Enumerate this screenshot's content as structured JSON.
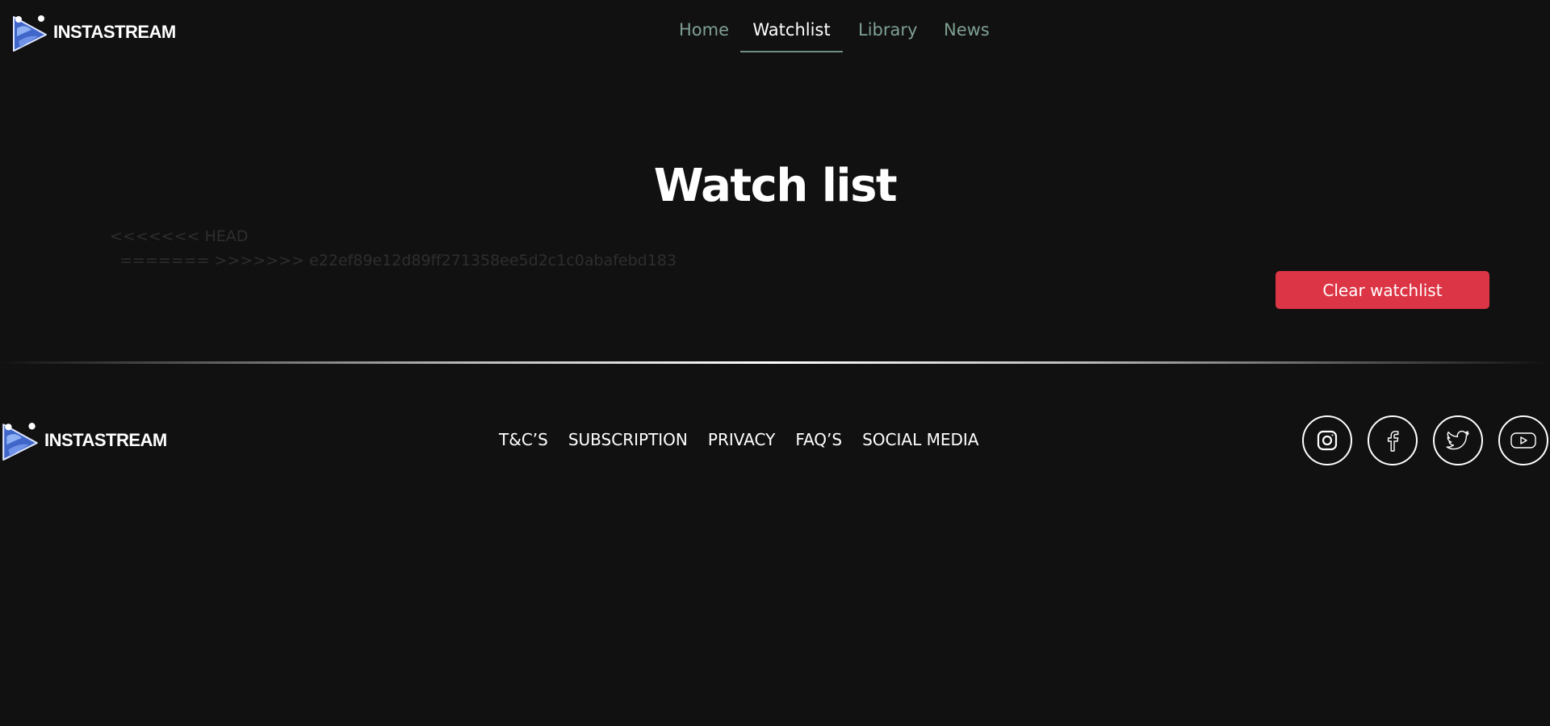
{
  "brand": {
    "name": "INSTASTREAM",
    "logo_icon": "play-logo-icon"
  },
  "nav": {
    "items": [
      {
        "label": "Home",
        "active": false
      },
      {
        "label": "Watchlist",
        "active": true
      },
      {
        "label": "Library",
        "active": false
      },
      {
        "label": "News",
        "active": false
      }
    ]
  },
  "main": {
    "title": "Watch list",
    "conflict_lines": [
      "<<<<<<< HEAD",
      "  ======= >>>>>>> e22ef89e12d89ff271358ee5d2c1c0abafebd183"
    ],
    "clear_button": "Clear watchlist"
  },
  "footer": {
    "links": [
      "T&C’S",
      "SUBSCRIPTION",
      "PRIVACY",
      "FAQ’S",
      "SOCIAL MEDIA"
    ],
    "social": [
      {
        "icon": "instagram-icon"
      },
      {
        "icon": "facebook-icon"
      },
      {
        "icon": "twitter-icon"
      },
      {
        "icon": "youtube-icon"
      }
    ]
  },
  "colors": {
    "background": "#111111",
    "nav_inactive": "#7ea092",
    "nav_underline": "#6f8f80",
    "danger": "#dc3545",
    "text": "#ffffff"
  }
}
